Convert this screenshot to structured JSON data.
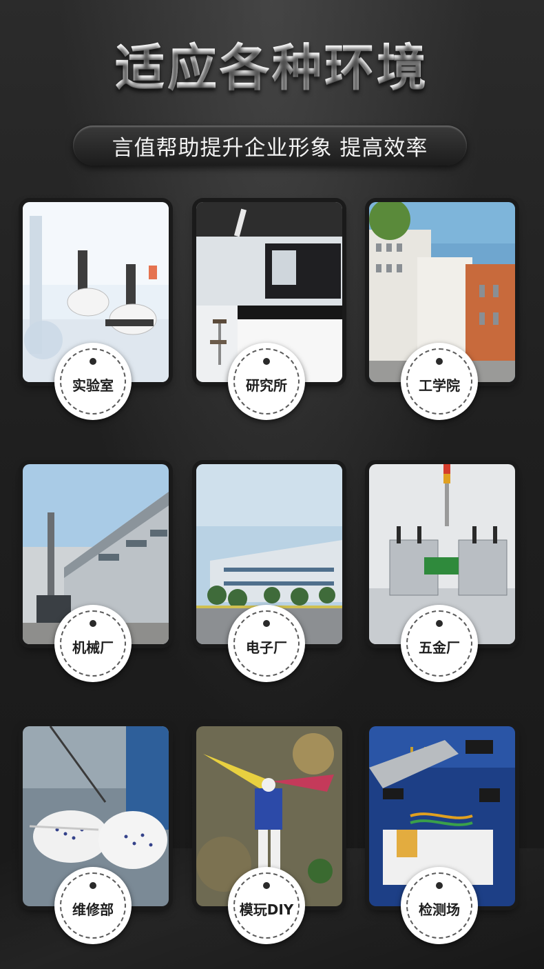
{
  "header": {
    "title": "适应各种环境",
    "subtitle": "言值帮助提升企业形象 提高效率"
  },
  "environments": [
    {
      "label": "实验室"
    },
    {
      "label": "研究所"
    },
    {
      "label": "工学院"
    },
    {
      "label": "机械厂"
    },
    {
      "label": "电子厂"
    },
    {
      "label": "五金厂"
    },
    {
      "label": "维修部"
    },
    {
      "label": "模玩DIY"
    },
    {
      "label": "检测场"
    }
  ]
}
